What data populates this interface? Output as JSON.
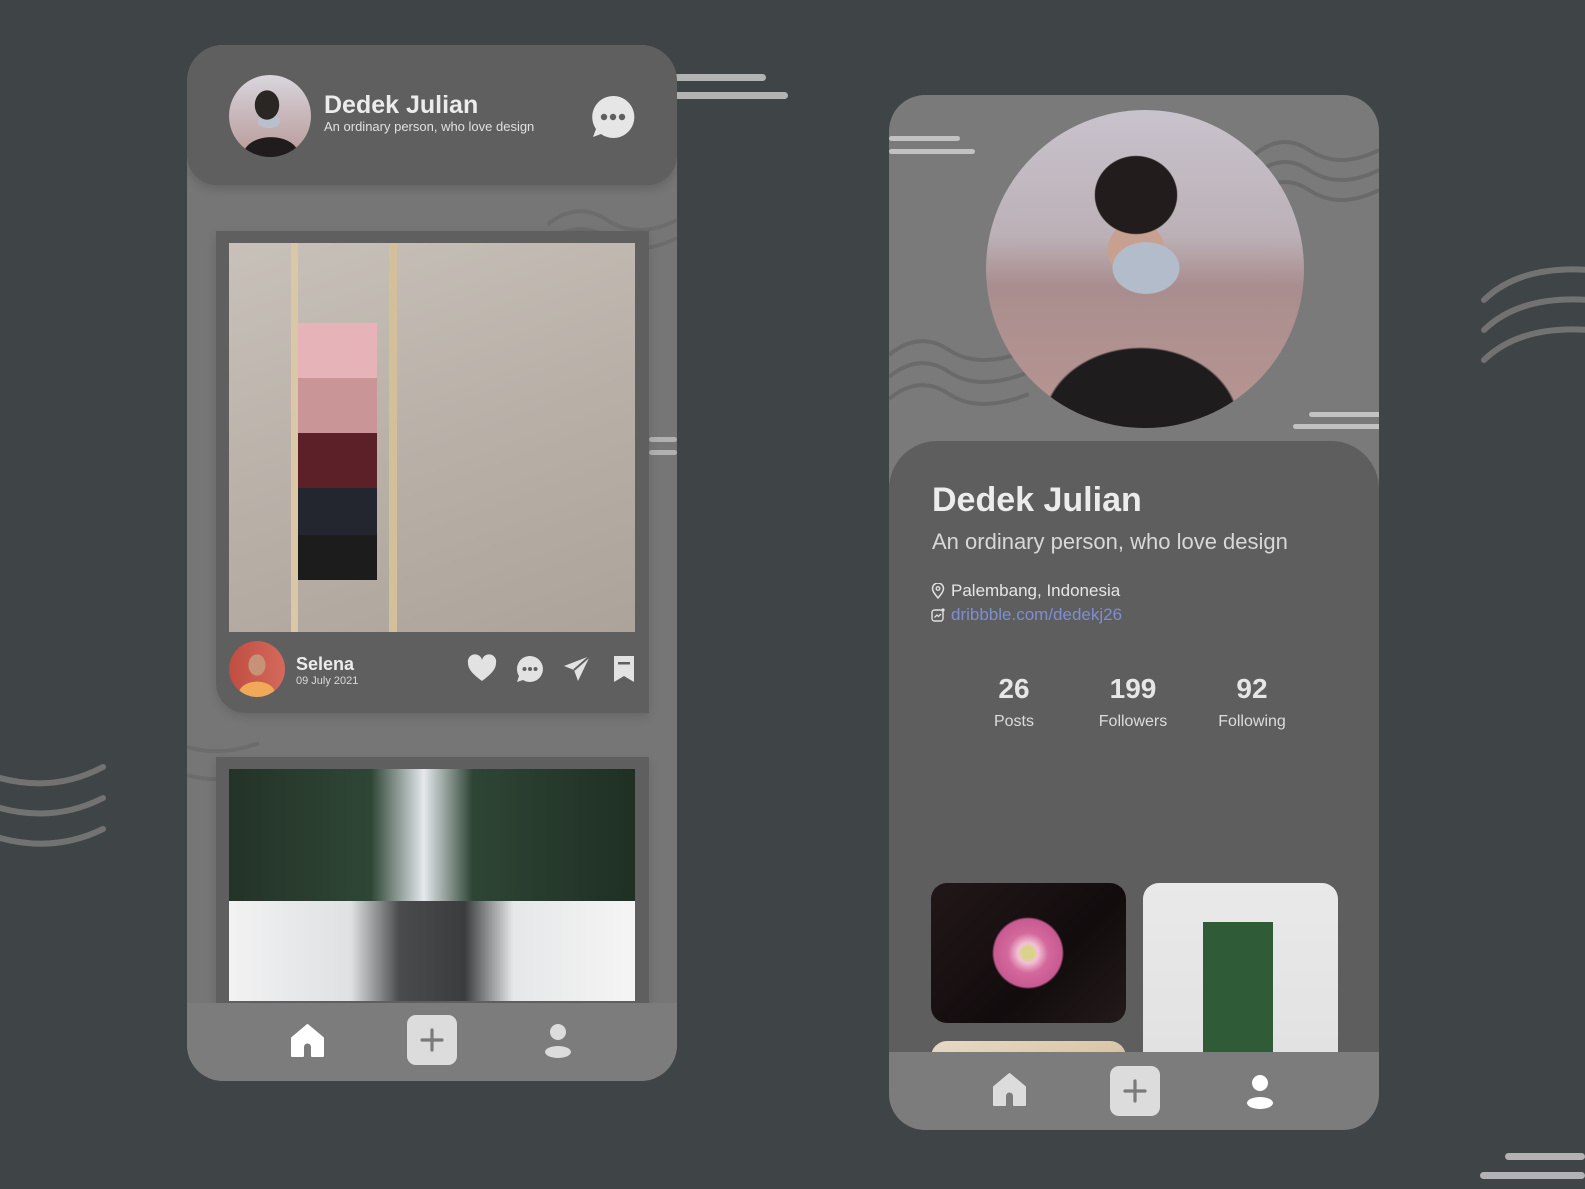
{
  "feed_screen": {
    "header": {
      "name": "Dedek Julian",
      "bio": "An ordinary person, who love design",
      "avatar_icon": "user-avatar",
      "chat_icon": "chat-bubble-icon"
    },
    "posts": [
      {
        "image": "ladder-with-blankets-photo",
        "author": "Selena",
        "date": "09 July 2021",
        "actions": [
          "like",
          "comment",
          "share",
          "bookmark"
        ]
      },
      {
        "image": "snowy-forest-road-photo"
      }
    ],
    "nav": {
      "items": [
        "home",
        "add",
        "profile"
      ],
      "active": "home"
    }
  },
  "profile_screen": {
    "name": "Dedek Julian",
    "bio": "An ordinary person, who love design",
    "location": "Palembang, Indonesia",
    "website": "dribbble.com/dedekj26",
    "stats": [
      {
        "value": "26",
        "label": "Posts"
      },
      {
        "value": "199",
        "label": "Followers"
      },
      {
        "value": "92",
        "label": "Following"
      }
    ],
    "gallery": [
      "pink-flower-photo",
      "sand-dunes-photo",
      "living-room-plant-photo"
    ],
    "nav": {
      "items": [
        "home",
        "add",
        "profile"
      ],
      "active": "profile"
    }
  },
  "colors": {
    "background": "#3f4446",
    "card": "#5f5f5f",
    "phone": "#767676",
    "link": "#7d8ed3",
    "text": "#ececec"
  }
}
